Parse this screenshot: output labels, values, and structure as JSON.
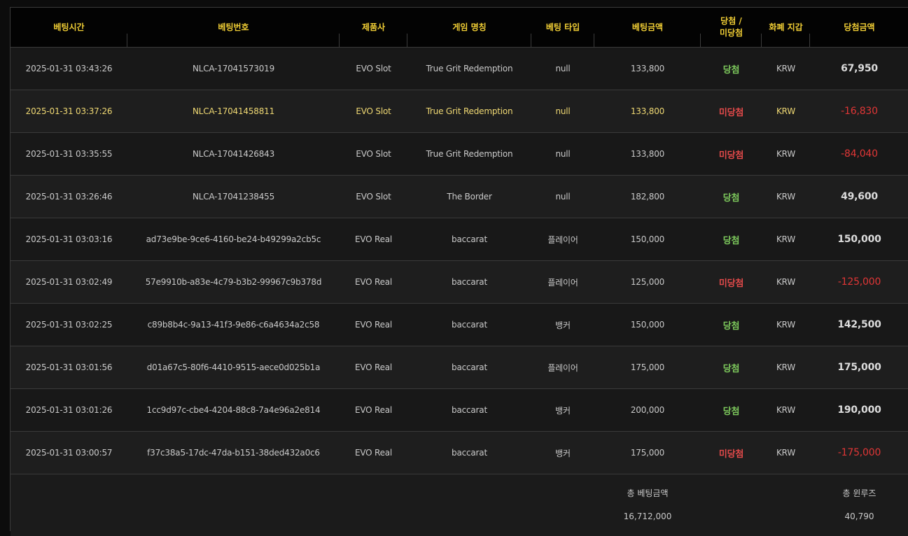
{
  "headers": [
    "베팅시간",
    "베팅번호",
    "제품사",
    "게임 명칭",
    "베팅 타입",
    "베팅금액",
    "당첨 / 미당첨",
    "화폐 지갑",
    "당첨금액"
  ],
  "header_result_line1": "당첨 /",
  "header_result_line2": "미당첨",
  "rows": [
    {
      "time": "2025-01-31 03:43:26",
      "id": "NLCA-17041573019",
      "provider": "EVO Slot",
      "game": "True Grit Redemption",
      "type": "null",
      "bet": "133,800",
      "result": "당첨",
      "currency": "KRW",
      "payout": "67,950"
    },
    {
      "time": "2025-01-31 03:37:26",
      "id": "NLCA-17041458811",
      "provider": "EVO Slot",
      "game": "True Grit Redemption",
      "type": "null",
      "bet": "133,800",
      "result": "미당첨",
      "currency": "KRW",
      "payout": "-16,830"
    },
    {
      "time": "2025-01-31 03:35:55",
      "id": "NLCA-17041426843",
      "provider": "EVO Slot",
      "game": "True Grit Redemption",
      "type": "null",
      "bet": "133,800",
      "result": "미당첨",
      "currency": "KRW",
      "payout": "-84,040"
    },
    {
      "time": "2025-01-31 03:26:46",
      "id": "NLCA-17041238455",
      "provider": "EVO Slot",
      "game": "The Border",
      "type": "null",
      "bet": "182,800",
      "result": "당첨",
      "currency": "KRW",
      "payout": "49,600"
    },
    {
      "time": "2025-01-31 03:03:16",
      "id": "ad73e9be-9ce6-4160-be24-b49299a2cb5c",
      "provider": "EVO Real",
      "game": "baccarat",
      "type": "플레이어",
      "bet": "150,000",
      "result": "당첨",
      "currency": "KRW",
      "payout": "150,000"
    },
    {
      "time": "2025-01-31 03:02:49",
      "id": "57e9910b-a83e-4c79-b3b2-99967c9b378d",
      "provider": "EVO Real",
      "game": "baccarat",
      "type": "플레이어",
      "bet": "125,000",
      "result": "미당첨",
      "currency": "KRW",
      "payout": "-125,000"
    },
    {
      "time": "2025-01-31 03:02:25",
      "id": "c89b8b4c-9a13-41f3-9e86-c6a4634a2c58",
      "provider": "EVO Real",
      "game": "baccarat",
      "type": "뱅커",
      "bet": "150,000",
      "result": "당첨",
      "currency": "KRW",
      "payout": "142,500"
    },
    {
      "time": "2025-01-31 03:01:56",
      "id": "d01a67c5-80f6-4410-9515-aece0d025b1a",
      "provider": "EVO Real",
      "game": "baccarat",
      "type": "플레이어",
      "bet": "175,000",
      "result": "당첨",
      "currency": "KRW",
      "payout": "175,000"
    },
    {
      "time": "2025-01-31 03:01:26",
      "id": "1cc9d97c-cbe4-4204-88c8-7a4e96a2e814",
      "provider": "EVO Real",
      "game": "baccarat",
      "type": "뱅커",
      "bet": "200,000",
      "result": "당첨",
      "currency": "KRW",
      "payout": "190,000"
    },
    {
      "time": "2025-01-31 03:00:57",
      "id": "f37c38a5-17dc-47da-b151-38ded432a0c6",
      "provider": "EVO Real",
      "game": "baccarat",
      "type": "뱅커",
      "bet": "175,000",
      "result": "미당첨",
      "currency": "KRW",
      "payout": "-175,000"
    }
  ],
  "highlight_row": 1,
  "summary": {
    "total_bet_label": "총 베팅금액",
    "total_bet_value": "16,712,000",
    "total_winloss_label": "총 윈루즈",
    "total_winloss_value": "40,790"
  },
  "colors": {
    "header_text": "#f2cf35",
    "win": "#7dc95c",
    "lose": "#e34a4a",
    "negative_amount": "#e03636",
    "highlight_text": "#efd873"
  }
}
